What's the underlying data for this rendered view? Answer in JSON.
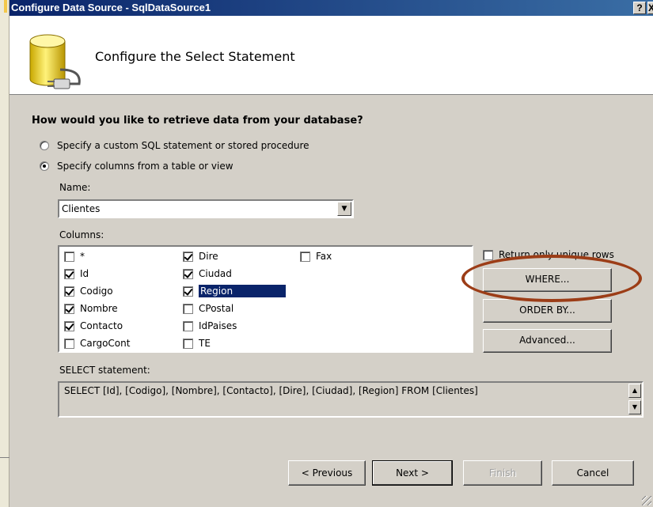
{
  "window": {
    "title": "Configure Data Source - SqlDataSource1",
    "help_label": "?",
    "close_label": "X"
  },
  "header": {
    "title": "Configure the Select Statement",
    "icon": "database-plug-icon"
  },
  "question": "How would you like to retrieve data from your database?",
  "options": {
    "custom_sql": {
      "label": "Specify a custom SQL statement or stored procedure",
      "selected": false
    },
    "columns": {
      "label": "Specify columns from a table or view",
      "selected": true
    }
  },
  "name_field": {
    "label": "Name:",
    "value": "Clientes"
  },
  "columns": {
    "label": "Columns:",
    "items": [
      {
        "label": "*",
        "checked": false
      },
      {
        "label": "Id",
        "checked": true
      },
      {
        "label": "Codigo",
        "checked": true
      },
      {
        "label": "Nombre",
        "checked": true
      },
      {
        "label": "Contacto",
        "checked": true
      },
      {
        "label": "CargoCont",
        "checked": false
      },
      {
        "label": "Dire",
        "checked": true
      },
      {
        "label": "Ciudad",
        "checked": true
      },
      {
        "label": "Region",
        "checked": true,
        "selected": true
      },
      {
        "label": "CPostal",
        "checked": false
      },
      {
        "label": "IdPaises",
        "checked": false
      },
      {
        "label": "TE",
        "checked": false
      },
      {
        "label": "Fax",
        "checked": false
      }
    ]
  },
  "unique_rows": {
    "label": "Return only unique rows",
    "checked": false
  },
  "buttons": {
    "where": "WHERE...",
    "order_by": "ORDER BY...",
    "advanced": "Advanced...",
    "previous": "< Previous",
    "next": "Next >",
    "finish": "Finish",
    "cancel": "Cancel"
  },
  "select_statement": {
    "label": "SELECT statement:",
    "value": "SELECT [Id], [Codigo], [Nombre], [Contacto], [Dire], [Ciudad], [Region] FROM [Clientes]"
  },
  "colors": {
    "title_bar": "#0a246a",
    "dialog_bg": "#d4d0c8",
    "selection": "#0a246a",
    "highlight_ellipse": "#9c3d17"
  }
}
